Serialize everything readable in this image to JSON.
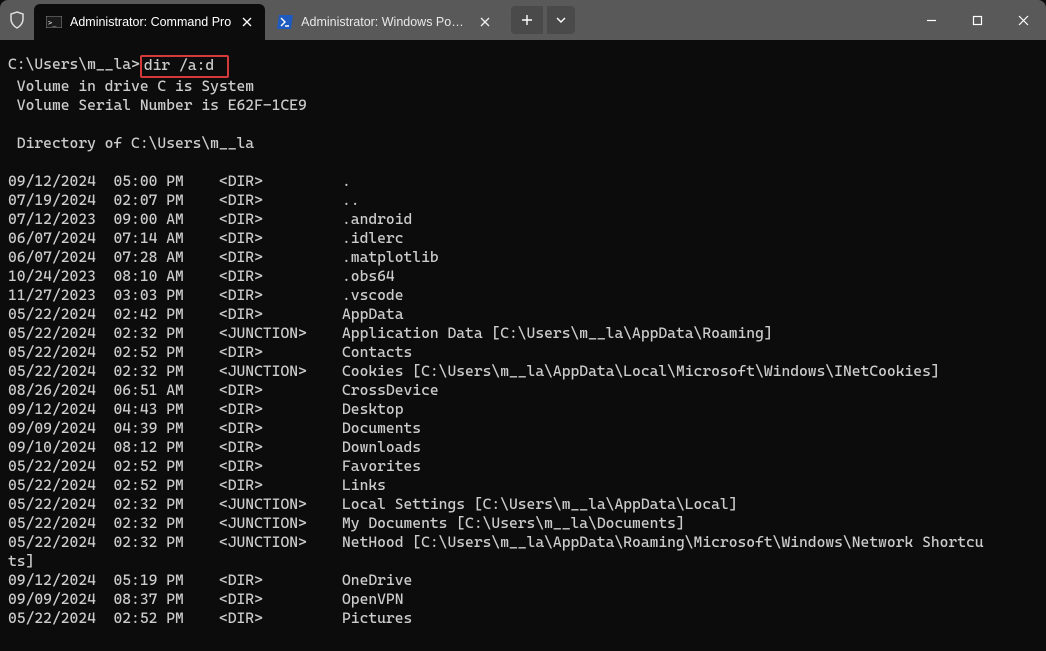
{
  "window": {
    "tabs": [
      {
        "label": "Administrator: Command Pro"
      },
      {
        "label": "Administrator: Windows Power"
      }
    ]
  },
  "prompt": {
    "path": "C:\\Users\\m__la>",
    "command": "dir /a:d"
  },
  "header_lines": [
    " Volume in drive C is System",
    " Volume Serial Number is E62F-1CE9",
    "",
    " Directory of C:\\Users\\m__la",
    ""
  ],
  "listing": [
    {
      "date": "09/12/2024",
      "time": "05:00 PM",
      "type": "<DIR>",
      "name": "."
    },
    {
      "date": "07/19/2024",
      "time": "02:07 PM",
      "type": "<DIR>",
      "name": ".."
    },
    {
      "date": "07/12/2023",
      "time": "09:00 AM",
      "type": "<DIR>",
      "name": ".android"
    },
    {
      "date": "06/07/2024",
      "time": "07:14 AM",
      "type": "<DIR>",
      "name": ".idlerc"
    },
    {
      "date": "06/07/2024",
      "time": "07:28 AM",
      "type": "<DIR>",
      "name": ".matplotlib"
    },
    {
      "date": "10/24/2023",
      "time": "08:10 AM",
      "type": "<DIR>",
      "name": ".obs64"
    },
    {
      "date": "11/27/2023",
      "time": "03:03 PM",
      "type": "<DIR>",
      "name": ".vscode"
    },
    {
      "date": "05/22/2024",
      "time": "02:42 PM",
      "type": "<DIR>",
      "name": "AppData"
    },
    {
      "date": "05/22/2024",
      "time": "02:32 PM",
      "type": "<JUNCTION>",
      "name": "Application Data [C:\\Users\\m__la\\AppData\\Roaming]"
    },
    {
      "date": "05/22/2024",
      "time": "02:52 PM",
      "type": "<DIR>",
      "name": "Contacts"
    },
    {
      "date": "05/22/2024",
      "time": "02:32 PM",
      "type": "<JUNCTION>",
      "name": "Cookies [C:\\Users\\m__la\\AppData\\Local\\Microsoft\\Windows\\INetCookies]"
    },
    {
      "date": "08/26/2024",
      "time": "06:51 AM",
      "type": "<DIR>",
      "name": "CrossDevice"
    },
    {
      "date": "09/12/2024",
      "time": "04:43 PM",
      "type": "<DIR>",
      "name": "Desktop"
    },
    {
      "date": "09/09/2024",
      "time": "04:39 PM",
      "type": "<DIR>",
      "name": "Documents"
    },
    {
      "date": "09/10/2024",
      "time": "08:12 PM",
      "type": "<DIR>",
      "name": "Downloads"
    },
    {
      "date": "05/22/2024",
      "time": "02:52 PM",
      "type": "<DIR>",
      "name": "Favorites"
    },
    {
      "date": "05/22/2024",
      "time": "02:52 PM",
      "type": "<DIR>",
      "name": "Links"
    },
    {
      "date": "05/22/2024",
      "time": "02:32 PM",
      "type": "<JUNCTION>",
      "name": "Local Settings [C:\\Users\\m__la\\AppData\\Local]"
    },
    {
      "date": "05/22/2024",
      "time": "02:32 PM",
      "type": "<JUNCTION>",
      "name": "My Documents [C:\\Users\\m__la\\Documents]"
    },
    {
      "date": "05/22/2024",
      "time": "02:32 PM",
      "type": "<JUNCTION>",
      "name": "NetHood [C:\\Users\\m__la\\AppData\\Roaming\\Microsoft\\Windows\\Network Shortcu",
      "cont": "ts]"
    },
    {
      "date": "09/12/2024",
      "time": "05:19 PM",
      "type": "<DIR>",
      "name": "OneDrive"
    },
    {
      "date": "09/09/2024",
      "time": "08:37 PM",
      "type": "<DIR>",
      "name": "OpenVPN"
    },
    {
      "date": "05/22/2024",
      "time": "02:52 PM",
      "type": "<DIR>",
      "name": "Pictures"
    }
  ]
}
